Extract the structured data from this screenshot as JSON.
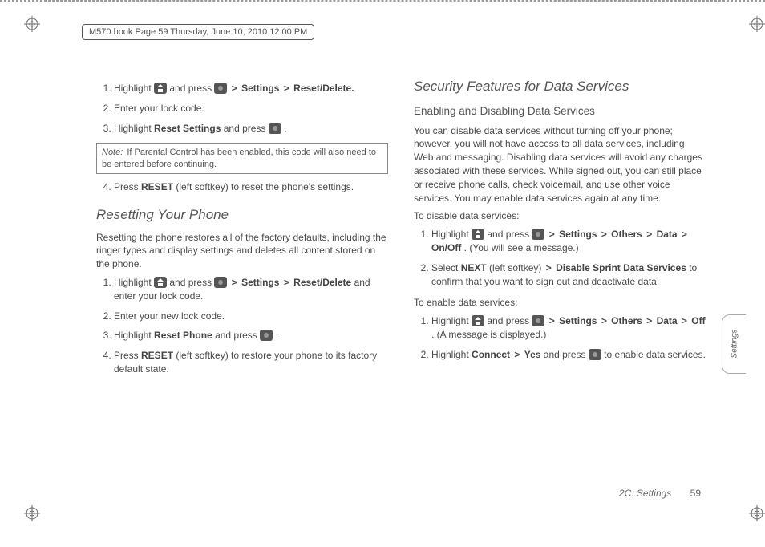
{
  "header": {
    "book_info": "M570.book  Page 59  Thursday, June 10, 2010  12:00 PM"
  },
  "left": {
    "step1_a": "Highlight ",
    "step1_b": " and press ",
    "path_settings": "Settings",
    "path_reset_delete": "Reset/Delete.",
    "step2": "Enter your lock code.",
    "step3_a": "Highlight ",
    "step3_bold": "Reset Settings",
    "step3_b": " and press ",
    "step3_c": ".",
    "note_label": "Note:",
    "note_text": "If Parental Control has been enabled, this code will also need to be entered before continuing.",
    "step4_a": "Press ",
    "step4_bold": "RESET",
    "step4_b": " (left softkey) to reset the phone's settings.",
    "section_title": "Resetting Your Phone",
    "section_intro": "Resetting the phone restores all of the factory defaults, including the ringer types and display settings and deletes all content stored on the phone.",
    "r_step1_a": "Highlight ",
    "r_step1_b": " and press ",
    "r_step1_bold1": "Settings",
    "r_step1_bold2": "Reset/Delete",
    "r_step1_c": " and enter your lock code.",
    "r_step2": "Enter your new lock code.",
    "r_step3_a": "Highlight ",
    "r_step3_bold": "Reset Phone",
    "r_step3_b": " and press ",
    "r_step3_c": ".",
    "r_step4_a": "Press ",
    "r_step4_bold": "RESET",
    "r_step4_b": " (left softkey) to restore your phone to its factory default state."
  },
  "right": {
    "section_title": "Security Features for Data Services",
    "sub_title": "Enabling and Disabling Data Services",
    "intro": "You can disable data services without turning off your phone; however, you will not have access to all data services, including Web and messaging. Disabling data services will avoid any charges associated with these services. While signed out, you can still place or receive phone calls, check voicemail, and use other voice services. You may enable data services again at any time.",
    "disable_lead": "To disable data services:",
    "d_step1_a": "Highlight ",
    "d_step1_b": " and press ",
    "d_step1_bold1": "Settings",
    "d_step1_bold2": "Others",
    "d_step1_bold3": "Data",
    "d_step1_bold4": "On/Off",
    "d_step1_c": ". (You will see a message.)",
    "d_step2_a": "Select ",
    "d_step2_bold1": "NEXT",
    "d_step2_b": " (left softkey) ",
    "d_step2_bold2": "Disable Sprint Data Services",
    "d_step2_c": " to confirm that you want to sign out and deactivate data.",
    "enable_lead": "To enable data services:",
    "e_step1_a": "Highlight ",
    "e_step1_b": " and press ",
    "e_step1_bold1": "Settings",
    "e_step1_bold2": "Others",
    "e_step1_bold3": "Data",
    "e_step1_bold4": "Off",
    "e_step1_c": ". (A message is displayed.)",
    "e_step2_a": "Highlight ",
    "e_step2_bold1": "Connect",
    "e_step2_bold2": "Yes",
    "e_step2_b": " and press ",
    "e_step2_c": " to enable data services."
  },
  "footer": {
    "section": "2C. Settings",
    "page": "59"
  },
  "sidetab": "Settings",
  "sep": ">"
}
